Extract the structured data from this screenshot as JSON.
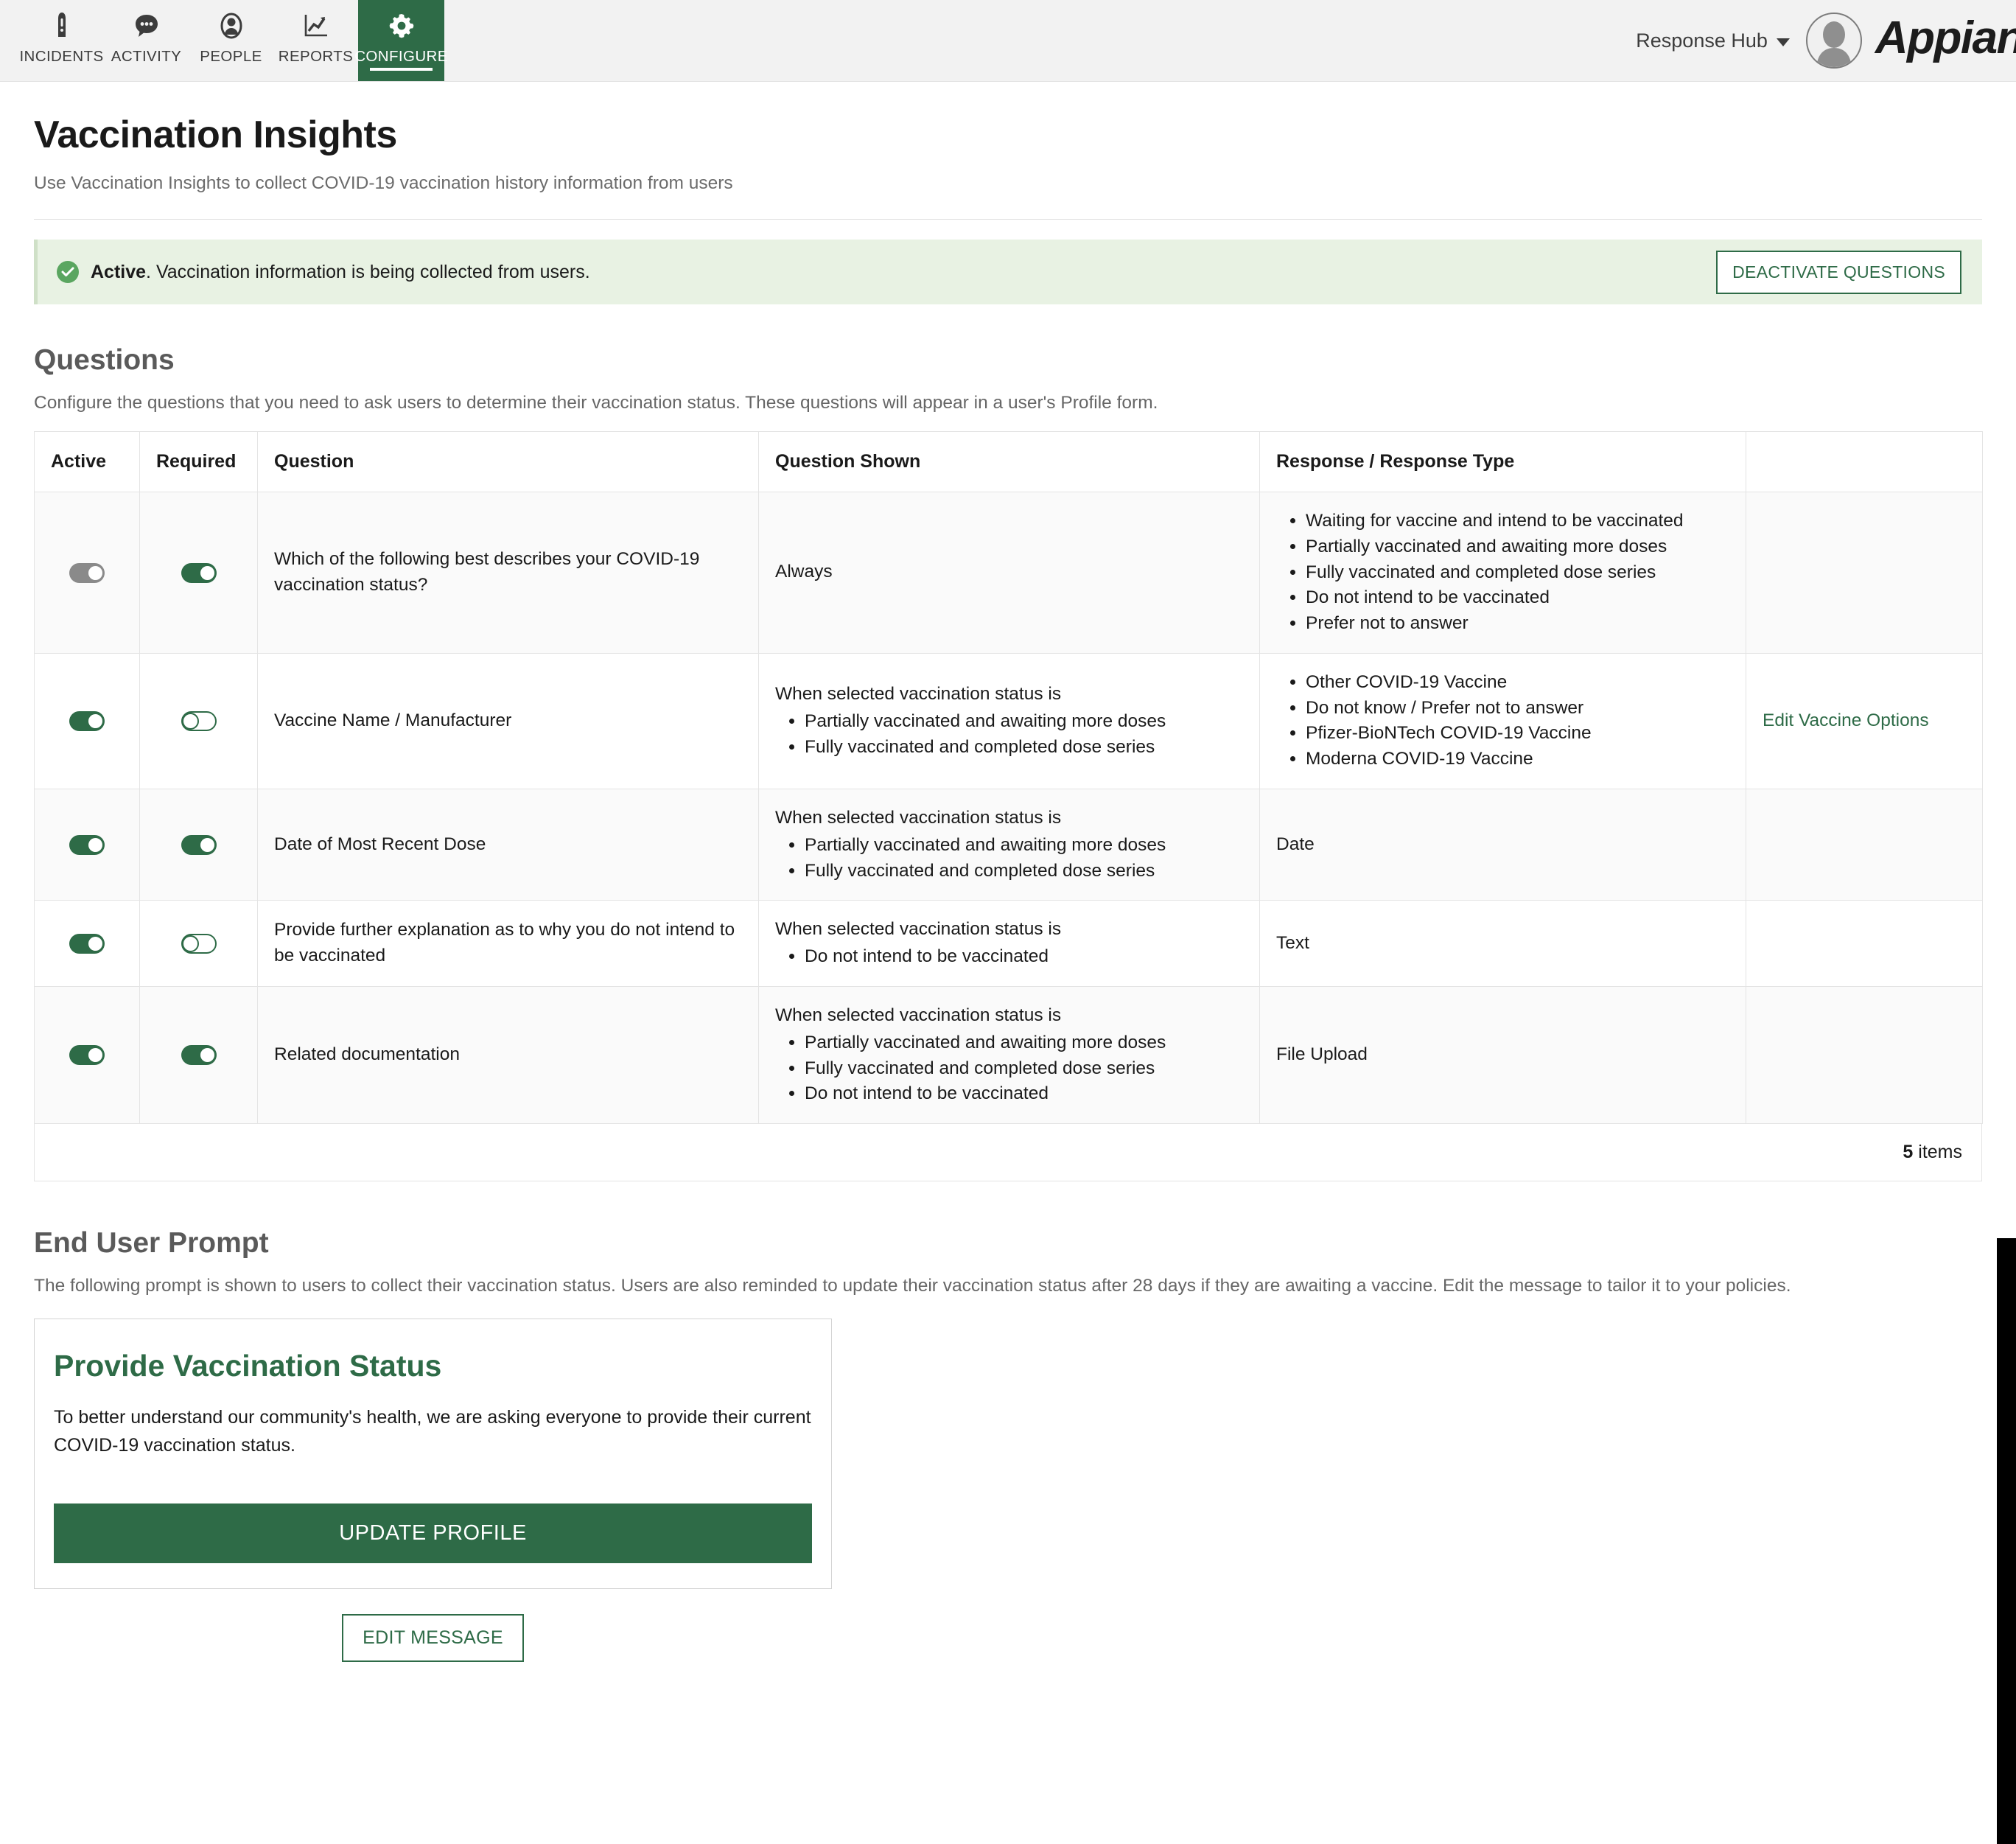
{
  "topnav": {
    "items": [
      {
        "label": "INCIDENTS",
        "icon": "warning-triangle-icon",
        "active": false
      },
      {
        "label": "ACTIVITY",
        "icon": "chat-bubble-icon",
        "active": false
      },
      {
        "label": "PEOPLE",
        "icon": "person-icon",
        "active": false
      },
      {
        "label": "REPORTS",
        "icon": "chart-trend-icon",
        "active": false
      },
      {
        "label": "CONFIGURE",
        "icon": "gear-icon",
        "active": true
      }
    ],
    "account_label": "Response Hub",
    "brand": "Appian"
  },
  "header": {
    "title": "Vaccination Insights",
    "subtitle": "Use Vaccination Insights to collect COVID-19 vaccination history information from users"
  },
  "banner": {
    "status_label": "Active",
    "message": ". Vaccination information is being collected from users.",
    "button_label": "DEACTIVATE QUESTIONS",
    "background_color": "#e8f2e3",
    "icon": "check-circle-icon"
  },
  "questions_section": {
    "title": "Questions",
    "description": "Configure the questions that you need to ask users to determine their vaccination status. These questions will appear in a user's Profile form.",
    "columns": [
      "Active",
      "Required",
      "Question",
      "Question Shown",
      "Response / Response Type",
      ""
    ],
    "rows": [
      {
        "active": "on-disabled",
        "required": "on",
        "question": "Which of the following best describes your COVID-19 vaccination status?",
        "shown_label": "Always",
        "shown_list": [],
        "response_type": "",
        "response_list": [
          "Waiting for vaccine and intend to be vaccinated",
          "Partially vaccinated and awaiting more doses",
          "Fully vaccinated and completed dose series",
          "Do not intend to be vaccinated",
          "Prefer not to answer"
        ],
        "edit_link": ""
      },
      {
        "active": "on",
        "required": "off",
        "question": "Vaccine Name / Manufacturer",
        "shown_label": "When selected vaccination status is",
        "shown_list": [
          "Partially vaccinated and awaiting more doses",
          "Fully vaccinated and completed dose series"
        ],
        "response_type": "",
        "response_list": [
          "Other COVID-19 Vaccine",
          "Do not know / Prefer not to answer",
          "Pfizer-BioNTech COVID-19 Vaccine",
          "Moderna COVID-19 Vaccine"
        ],
        "edit_link": "Edit Vaccine Options"
      },
      {
        "active": "on",
        "required": "on",
        "question": "Date of Most Recent Dose",
        "shown_label": "When selected vaccination status is",
        "shown_list": [
          "Partially vaccinated and awaiting more doses",
          "Fully vaccinated and completed dose series"
        ],
        "response_type": "Date",
        "response_list": [],
        "edit_link": ""
      },
      {
        "active": "on",
        "required": "off",
        "question": "Provide further explanation as to why you do not intend to be vaccinated",
        "shown_label": "When selected vaccination status is",
        "shown_list": [
          "Do not intend to be vaccinated"
        ],
        "response_type": "Text",
        "response_list": [],
        "edit_link": ""
      },
      {
        "active": "on",
        "required": "on",
        "question": "Related documentation",
        "shown_label": "When selected vaccination status is",
        "shown_list": [
          "Partially vaccinated and awaiting more doses",
          "Fully vaccinated and completed dose series",
          "Do not intend to be vaccinated"
        ],
        "response_type": "File Upload",
        "response_list": [],
        "edit_link": ""
      }
    ],
    "item_count": "5",
    "item_count_suffix": " items"
  },
  "end_user_prompt": {
    "title": "End User Prompt",
    "description": "The following prompt is shown to users to collect their vaccination status. Users are also reminded to update their vaccination status after 28 days if they are awaiting a vaccine. Edit the message to tailor it to your policies.",
    "card_title": "Provide Vaccination Status",
    "card_body": "To better understand our community's health, we are asking everyone to provide their current COVID-19 vaccination status.",
    "card_button_label": "UPDATE PROFILE",
    "edit_button_label": "EDIT MESSAGE"
  },
  "colors": {
    "brand_green": "#2e6b47",
    "banner_green": "#e8f2e3",
    "nav_bg": "#f2f2f2"
  }
}
